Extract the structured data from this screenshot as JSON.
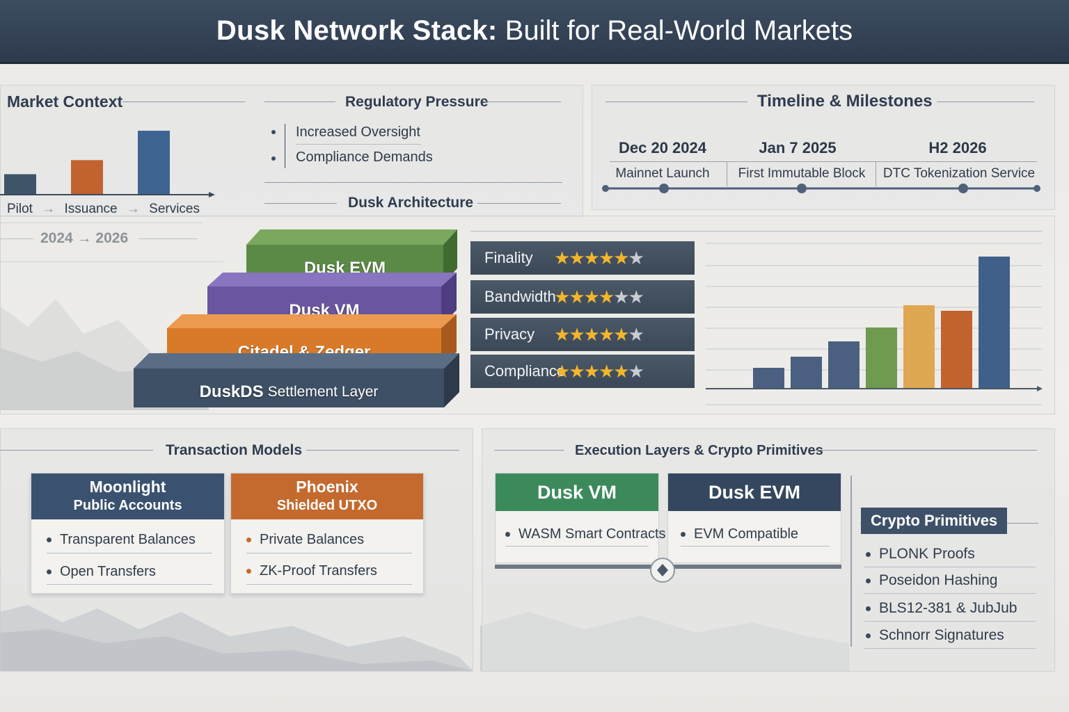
{
  "header": {
    "title_bold": "Dusk Network Stack:",
    "title_rest": "Built for Real-World Markets"
  },
  "market_context": {
    "heading": "Market Context",
    "stages": [
      "Pilot",
      "Issuance",
      "Services"
    ],
    "arrow": "→",
    "year_start": "2024",
    "year_end": "2026"
  },
  "regulatory_pressure": {
    "heading": "Regulatory Pressure",
    "items": [
      "Increased Oversight",
      "Compliance Demands"
    ]
  },
  "timeline": {
    "heading": "Timeline & Milestones",
    "milestones": [
      {
        "date": "Dec 20 2024",
        "event": "Mainnet Launch"
      },
      {
        "date": "Jan 7 2025",
        "event": "First Immutable Block"
      },
      {
        "date": "H2 2026",
        "event": "DTC Tokenization Service"
      }
    ]
  },
  "architecture": {
    "heading": "Dusk Architecture",
    "layers": [
      {
        "label": "Dusk EVM",
        "color": "#5b8a46"
      },
      {
        "label": "Dusk VM",
        "color": "#6a56a0"
      },
      {
        "label": "Citadel & Zedger",
        "color": "#d97a28"
      },
      {
        "label_bold": "DuskDS",
        "label_rest": "Settlement Layer",
        "color": "#3e5066"
      }
    ]
  },
  "ratings": [
    {
      "label": "Finality",
      "stars": 5
    },
    {
      "label": "Bandwidth",
      "stars": 4
    },
    {
      "label": "Privacy",
      "stars": 5
    },
    {
      "label": "Compliance",
      "stars": 5
    }
  ],
  "rating_star_glyph": "★",
  "rating_max": 6,
  "growth_chart": {
    "values": [
      1.5,
      2.3,
      3.4,
      4.4,
      6.0,
      5.6,
      9.5
    ],
    "colors": [
      "#4b6080",
      "#4b6080",
      "#4b6080",
      "#6f9a50",
      "#e0a752",
      "#c2622e",
      "#40608a"
    ],
    "ymax": 10
  },
  "market_chart": {
    "values": [
      3.2,
      5.4,
      10.0
    ],
    "colors": [
      "#3f5468",
      "#c2622e",
      "#3d6490"
    ]
  },
  "transaction_models": {
    "heading": "Transaction Models",
    "models": [
      {
        "title": "Moonlight",
        "subtitle": "Public Accounts",
        "color": "#3a5270",
        "bullet": "#3a4a5c",
        "items": [
          "Transparent Balances",
          "Open Transfers"
        ]
      },
      {
        "title": "Phoenix",
        "subtitle": "Shielded UTXO",
        "color": "#c46a2e",
        "bullet": "#c46a2e",
        "items": [
          "Private Balances",
          "ZK-Proof Transfers"
        ]
      }
    ]
  },
  "execution": {
    "heading": "Execution Layers & Crypto Primitives",
    "layers": [
      {
        "title": "Dusk VM",
        "color": "#3c8a5c",
        "item": "WASM Smart Contracts"
      },
      {
        "title": "Dusk EVM",
        "color": "#34475e",
        "item": "EVM Compatible"
      }
    ],
    "crypto": {
      "heading": "Crypto Primitives",
      "items": [
        "PLONK Proofs",
        "Poseidon Hashing",
        "BLS12-381 & JubJub",
        "Schnorr Signatures"
      ]
    }
  }
}
